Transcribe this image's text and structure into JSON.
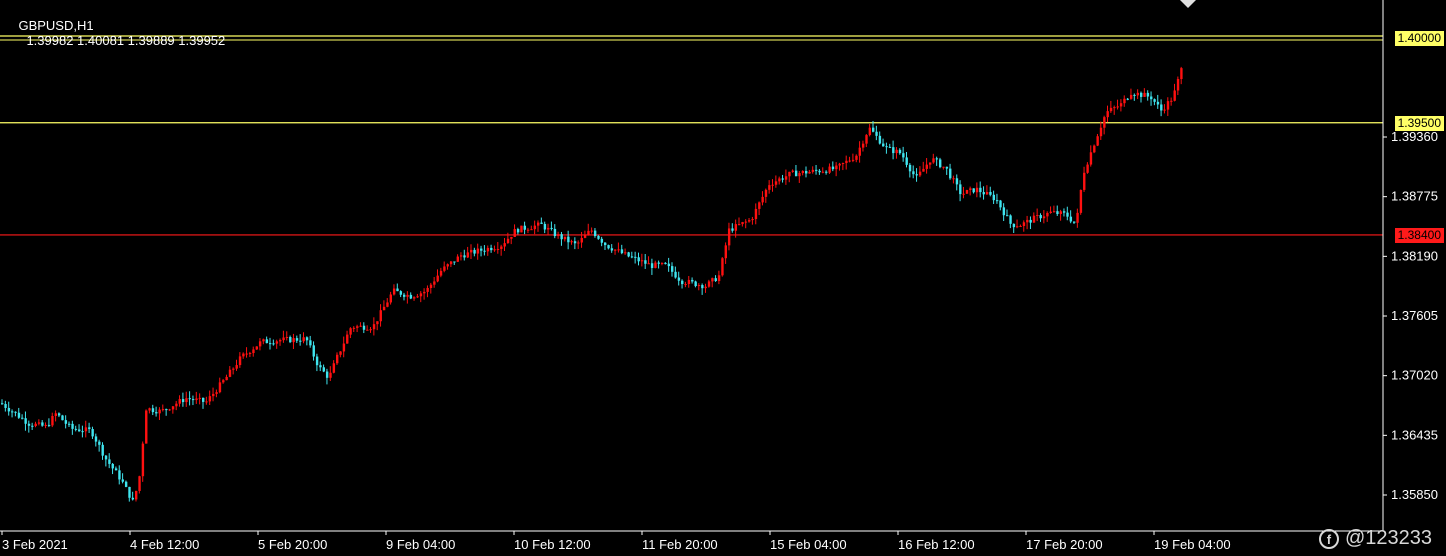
{
  "chart_header": {
    "symbol": "GBPUSD,H1",
    "ohlc": "1.39982 1.40081 1.39889 1.39952"
  },
  "watermark": {
    "text": "@123233",
    "icon": "logo-icon"
  },
  "colors": {
    "background": "#000000",
    "bull_candle": "#ff1010",
    "bear_candle": "#3fe5ef",
    "level_yellow": "#ffff66",
    "level_red": "#ff1a1a",
    "axis_text": "#ffffff",
    "axis_line": "#ffffff"
  },
  "chart_data": {
    "type": "candlestick",
    "title": "GBPUSD,H1",
    "y_axis": {
      "ticks": [
        "1.39360",
        "1.38775",
        "1.38190",
        "1.37605",
        "1.37020",
        "1.36435",
        "1.35850"
      ],
      "range": [
        1.3545,
        1.4035
      ],
      "position": "right"
    },
    "x_axis": {
      "ticks": [
        "3 Feb 2021",
        "4 Feb 12:00",
        "5 Feb 20:00",
        "9 Feb 04:00",
        "10 Feb 12:00",
        "11 Feb 20:00",
        "15 Feb 04:00",
        "16 Feb 12:00",
        "17 Feb 20:00",
        "19 Feb 04:00"
      ]
    },
    "horizontal_levels": [
      {
        "price": 1.4,
        "label": "1.40000",
        "color": "#ffff66",
        "double": true
      },
      {
        "price": 1.395,
        "label": "1.39500",
        "color": "#ffff66",
        "double": false
      },
      {
        "price": 1.384,
        "label": "1.38400",
        "color": "#ff1a1a",
        "double": false
      }
    ],
    "path_anchors": [
      [
        0,
        1.3675
      ],
      [
        28,
        1.3655
      ],
      [
        45,
        1.3652
      ],
      [
        55,
        1.3665
      ],
      [
        70,
        1.365
      ],
      [
        90,
        1.3648
      ],
      [
        105,
        1.362
      ],
      [
        120,
        1.36
      ],
      [
        132,
        1.3578
      ],
      [
        138,
        1.36
      ],
      [
        145,
        1.367
      ],
      [
        160,
        1.3667
      ],
      [
        185,
        1.368
      ],
      [
        205,
        1.3676
      ],
      [
        225,
        1.37
      ],
      [
        240,
        1.372
      ],
      [
        260,
        1.3735
      ],
      [
        280,
        1.3737
      ],
      [
        305,
        1.3738
      ],
      [
        318,
        1.371
      ],
      [
        328,
        1.37
      ],
      [
        335,
        1.3718
      ],
      [
        350,
        1.375
      ],
      [
        372,
        1.375
      ],
      [
        392,
        1.3785
      ],
      [
        410,
        1.378
      ],
      [
        425,
        1.3785
      ],
      [
        440,
        1.3805
      ],
      [
        460,
        1.382
      ],
      [
        500,
        1.383
      ],
      [
        515,
        1.3845
      ],
      [
        540,
        1.385
      ],
      [
        555,
        1.384
      ],
      [
        575,
        1.383
      ],
      [
        590,
        1.3845
      ],
      [
        605,
        1.383
      ],
      [
        625,
        1.382
      ],
      [
        650,
        1.381
      ],
      [
        665,
        1.381
      ],
      [
        680,
        1.3795
      ],
      [
        705,
        1.379
      ],
      [
        718,
        1.38
      ],
      [
        728,
        1.3845
      ],
      [
        750,
        1.3855
      ],
      [
        768,
        1.389
      ],
      [
        790,
        1.39
      ],
      [
        810,
        1.3902
      ],
      [
        835,
        1.3905
      ],
      [
        855,
        1.3918
      ],
      [
        868,
        1.3945
      ],
      [
        885,
        1.3925
      ],
      [
        900,
        1.392
      ],
      [
        915,
        1.3895
      ],
      [
        930,
        1.3915
      ],
      [
        945,
        1.3905
      ],
      [
        960,
        1.388
      ],
      [
        975,
        1.3885
      ],
      [
        995,
        1.3875
      ],
      [
        1010,
        1.385
      ],
      [
        1020,
        1.385
      ],
      [
        1035,
        1.3857
      ],
      [
        1050,
        1.3862
      ],
      [
        1065,
        1.386
      ],
      [
        1075,
        1.385
      ],
      [
        1082,
        1.39
      ],
      [
        1095,
        1.3935
      ],
      [
        1105,
        1.396
      ],
      [
        1120,
        1.3968
      ],
      [
        1130,
        1.398
      ],
      [
        1150,
        1.3975
      ],
      [
        1160,
        1.3962
      ],
      [
        1172,
        1.3975
      ],
      [
        1182,
        1.4008
      ]
    ]
  }
}
